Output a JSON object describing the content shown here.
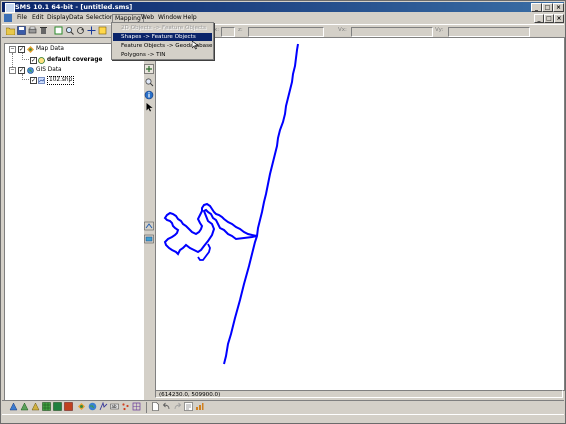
{
  "window": {
    "title": "SMS 10.1 64-bit - [untitled.sms]",
    "controls": [
      "_",
      "□",
      "×"
    ],
    "mdi_controls": [
      "_",
      "□",
      "×"
    ]
  },
  "menu": {
    "items": [
      "File",
      "Edit",
      "Display",
      "Data",
      "Selection",
      "Mapping",
      "Web",
      "Window",
      "Help"
    ],
    "active": "Mapping"
  },
  "mapping_menu": {
    "items": [
      {
        "label": "2D Objects -> Feature Objects",
        "state": "disabled"
      },
      {
        "label": "Shapes -> Feature Objects",
        "state": "highlighted"
      },
      {
        "label": "Feature Objects -> Geodatabase",
        "state": "normal"
      },
      {
        "label": "Polygons -> TIN",
        "state": "normal"
      }
    ]
  },
  "coord_labels": [
    "x:",
    "z:",
    "Vx:",
    "Vy:"
  ],
  "tree": {
    "map_data": "Map Data",
    "coverage": "default coverage",
    "gis_data": "GIS Data",
    "shapefile": "102.shp"
  },
  "status": {
    "coords": "(614230.0, 509900.0)"
  },
  "colors": {
    "selection": "#0a246a",
    "shape_line": "#0000ff",
    "panel": "#d4d0c8"
  }
}
